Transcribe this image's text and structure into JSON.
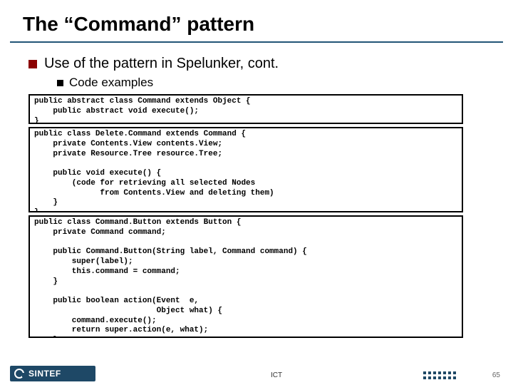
{
  "title": "The “Command” pattern",
  "bullets": {
    "level1": "Use of the pattern in Spelunker, cont.",
    "level2": "Code examples"
  },
  "code": {
    "box1": "public abstract class Command extends Object {\n    public abstract void execute();\n}",
    "box2": "public class Delete.Command extends Command {\n    private Contents.View contents.View;\n    private Resource.Tree resource.Tree;\n\n    public void execute() {\n        (code for retrieving all selected Nodes\n              from Contents.View and deleting them)\n    }\n}",
    "box3": "public class Command.Button extends Button {\n    private Command command;\n\n    public Command.Button(String label, Command command) {\n        super(label);\n        this.command = command;\n    }\n\n    public boolean action(Event  e,\n                          Object what) {\n        command.execute();\n        return super.action(e, what);\n    }\n}"
  },
  "footer": {
    "brand": "SINTEF",
    "dept": "ICT",
    "page": "65"
  }
}
